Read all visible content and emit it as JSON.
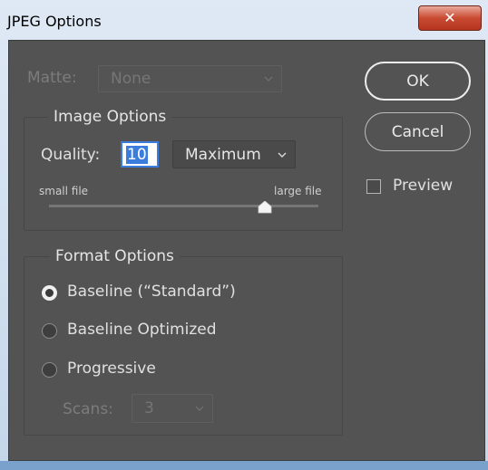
{
  "window": {
    "title": "JPEG Options",
    "close_glyph": "✕"
  },
  "matte": {
    "label": "Matte:",
    "value": "None"
  },
  "image_options": {
    "title": "Image Options",
    "quality_label": "Quality:",
    "quality_value": "10",
    "quality_preset": "Maximum",
    "slider_min_label": "small file",
    "slider_max_label": "large file",
    "slider_level": 0.8
  },
  "format_options": {
    "title": "Format Options",
    "options": [
      {
        "label": "Baseline (“Standard”)",
        "selected": true
      },
      {
        "label": "Baseline Optimized",
        "selected": false
      },
      {
        "label": "Progressive",
        "selected": false
      }
    ],
    "scans_label": "Scans:",
    "scans_value": "3"
  },
  "buttons": {
    "ok": "OK",
    "cancel": "Cancel"
  },
  "preview": {
    "label": "Preview",
    "checked": false
  },
  "colors": {
    "dialog_bg": "#535353",
    "close_red": "#c94a32"
  },
  "icons": [
    "close-icon",
    "chevron-down-icon",
    "slider-thumb-icon",
    "radio-icon",
    "checkbox-icon"
  ]
}
